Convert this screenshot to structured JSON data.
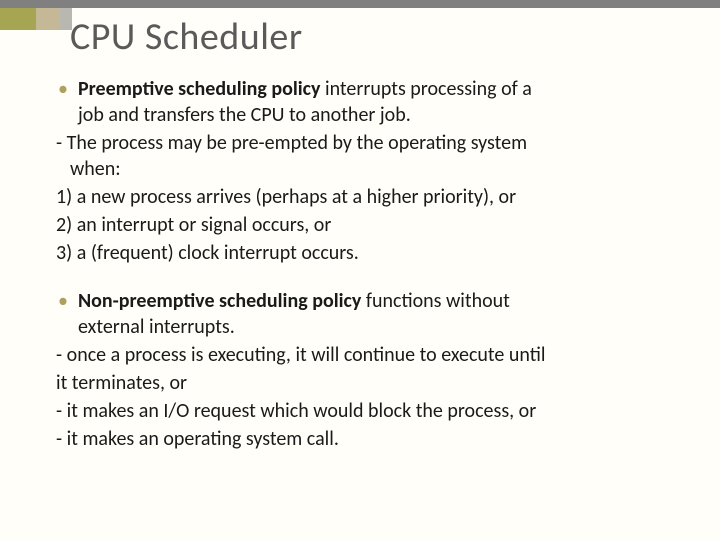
{
  "title": "CPU Scheduler",
  "b1_bold": "Preemptive scheduling policy",
  "b1_rest1": " interrupts processing of a",
  "b1_line2": "job and transfers the CPU to another job.",
  "d1": "- The process may be pre-empted by the operating system",
  "d1_line2": "when:",
  "n1": "1) a new process arrives (perhaps at a higher priority), or",
  "n2": "2) an interrupt or signal occurs, or",
  "n3": "3) a (frequent) clock interrupt occurs.",
  "b2_bold": "Non-preemptive scheduling policy",
  "b2_rest": " functions without",
  "b2_line2": "external interrupts.",
  "d2": "- once a process is executing, it will continue to execute until",
  "d2b": " it terminates, or",
  "d3": "- it makes an I/O request which would block the process, or",
  "d4": "- it makes an operating system call."
}
